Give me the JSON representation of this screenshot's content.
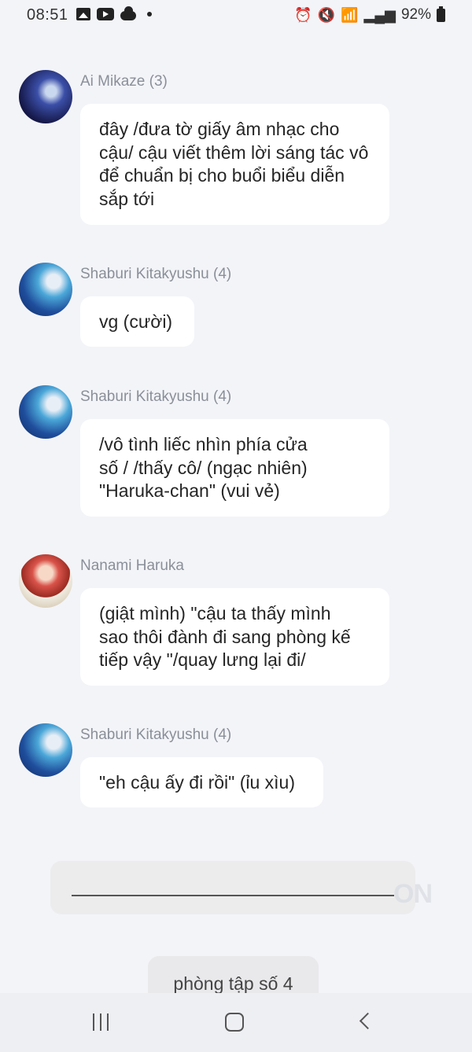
{
  "status_bar": {
    "time": "08:51",
    "battery": "92%",
    "left_icons": [
      "gallery-icon",
      "youtube-icon",
      "cloud-icon",
      "dot-icon"
    ],
    "right_icons": [
      "alarm-icon",
      "mute-icon",
      "wifi-icon",
      "signal-icon",
      "signal-icon",
      "battery-icon"
    ]
  },
  "messages": [
    {
      "sender": "Ai Mikaze (3)",
      "text": "đây /đưa tờ giấy âm nhạc cho cậu/ cậu viết thêm lời sáng tác vô để chuẩn bị cho buổi biểu diễn sắp tới"
    },
    {
      "sender": "Shaburi Kitakyushu (4)",
      "text": "vg (cười)"
    },
    {
      "sender": "Shaburi Kitakyushu (4)",
      "text": "/vô tình liếc nhìn phía cửa số / /thấy cô/ (ngạc nhiên) \"Haruka-chan\" (vui vẻ)"
    },
    {
      "sender": "Nanami Haruka",
      "text": "(giật mình) \"cậu ta thấy mình sao thôi đành đi sang phòng kế tiếp vậy \"/quay lưng lại đi/"
    },
    {
      "sender": "Shaburi Kitakyushu (4)",
      "text": "\"eh cậu ấy đi rồi\" (ỉu xìu)"
    }
  ],
  "room_label": "phòng tập số 4",
  "nav": {
    "recents_icon": "recents-icon",
    "home_icon": "home-icon",
    "back_icon": "back-icon"
  }
}
